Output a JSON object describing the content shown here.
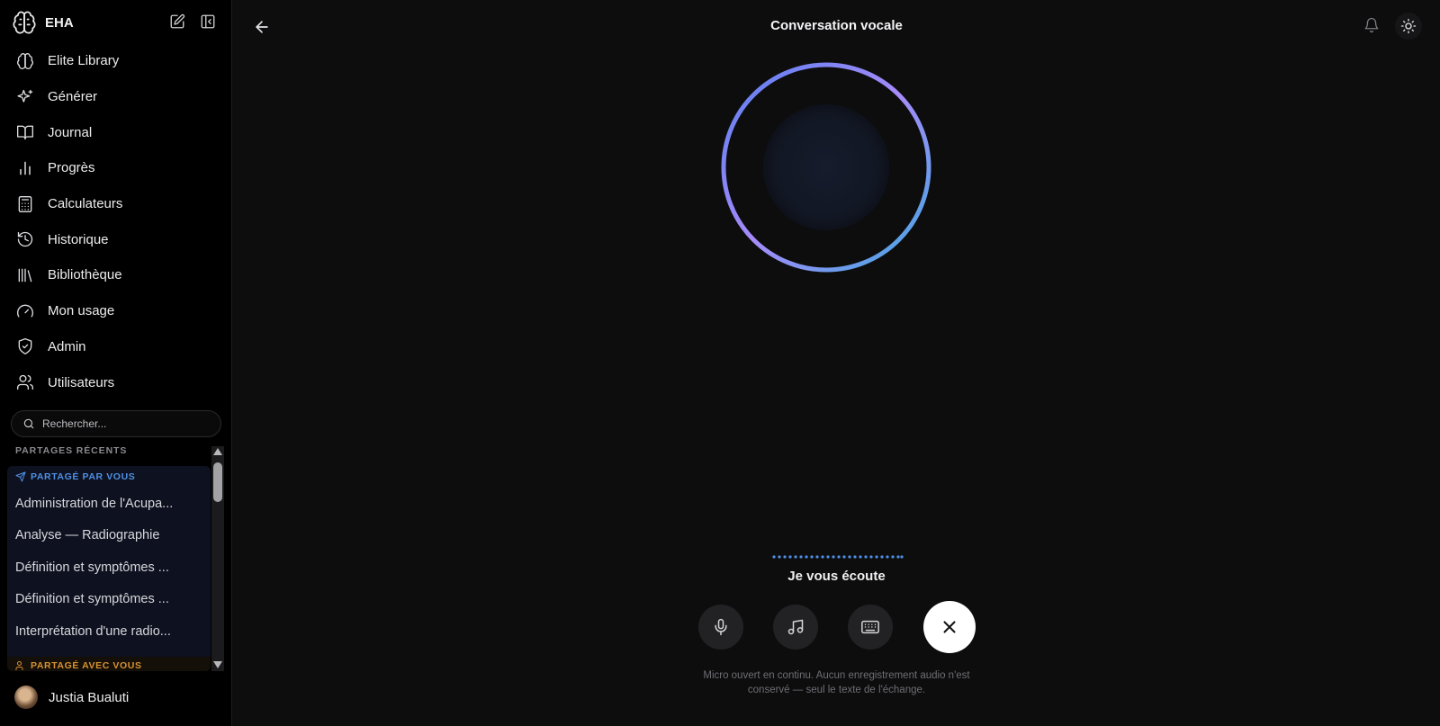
{
  "brand": {
    "name": "EHA"
  },
  "nav": {
    "items": [
      {
        "label": "Elite Library",
        "icon": "brain-icon"
      },
      {
        "label": "Générer",
        "icon": "sparkles-icon"
      },
      {
        "label": "Journal",
        "icon": "book-open-icon"
      },
      {
        "label": "Progrès",
        "icon": "bar-chart-icon"
      },
      {
        "label": "Calculateurs",
        "icon": "calculator-icon"
      },
      {
        "label": "Historique",
        "icon": "history-icon"
      },
      {
        "label": "Bibliothèque",
        "icon": "library-icon"
      },
      {
        "label": "Mon usage",
        "icon": "gauge-icon"
      },
      {
        "label": "Admin",
        "icon": "shield-check-icon"
      },
      {
        "label": "Utilisateurs",
        "icon": "users-icon"
      }
    ]
  },
  "search": {
    "placeholder": "Rechercher..."
  },
  "recent": {
    "label": "PARTAGES RÉCENTS",
    "shared_by_you": {
      "label": "PARTAGÉ PAR VOUS",
      "items": [
        "Administration de l'Acupa...",
        "Analyse — Radiographie",
        "Définition et symptômes ...",
        "Définition et symptômes ...",
        "Interprétation d'une radio..."
      ]
    },
    "shared_with_you": {
      "label": "PARTAGÉ AVEC VOUS"
    }
  },
  "user": {
    "name": "Justia Bualuti"
  },
  "main": {
    "title": "Conversation vocale",
    "status": "Je vous écoute",
    "note_line1": "Micro ouvert en continu. Aucun enregistrement audio n'est",
    "note_line2": "conservé — seul le texte de l'échange."
  },
  "colors": {
    "accent_blue": "#4f8fe6",
    "accent_orange": "#d9922f",
    "orb_ring_start": "#5a7ef0",
    "orb_ring_mid": "#a78bfa",
    "orb_ring_end": "#3fa8e0"
  }
}
